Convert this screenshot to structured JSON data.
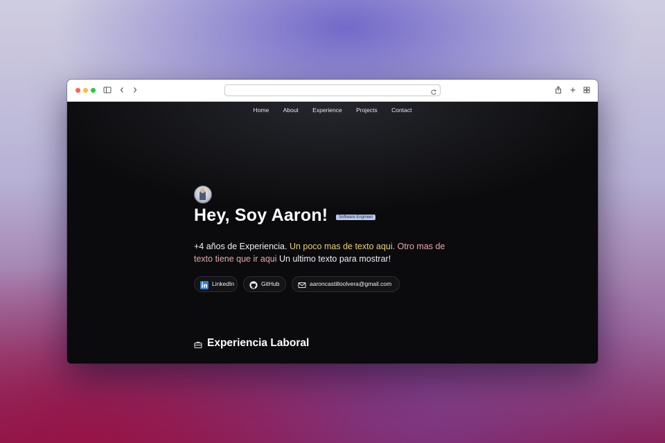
{
  "nav": {
    "items": [
      "Home",
      "About",
      "Experience",
      "Projects",
      "Contact"
    ]
  },
  "hero": {
    "title": "Hey, Soy Aaron!",
    "badge": "Software Engineer",
    "intro": {
      "part1": "+4 años de Experiencia.",
      "part2": "Un poco mas de texto aqui.",
      "part3": "Otro mas de texto tiene que ir aqui",
      "part4": "Un ultimo texto para mostrar!"
    }
  },
  "links": {
    "linkedin": "LinkedIn",
    "github": "GitHub",
    "email": "aaroncastilloolvera@gmail.com"
  },
  "experience": {
    "title": "Experiencia Laboral"
  },
  "colors": {
    "accent_yellow": "#e8d074",
    "accent_pink": "#e7a7b0",
    "badge_bg": "#b8c8ea",
    "page_bg": "#0b0b0d"
  },
  "icons": {
    "sidebar": "sidebar-icon",
    "back": "chevron-left-icon",
    "forward": "chevron-right-icon",
    "reload": "reload-icon",
    "share": "share-icon",
    "new_tab": "plus-icon",
    "tabs": "grid-icon",
    "linkedin": "linkedin-icon",
    "github": "github-icon",
    "email": "mail-icon",
    "experience": "briefcase-icon"
  }
}
